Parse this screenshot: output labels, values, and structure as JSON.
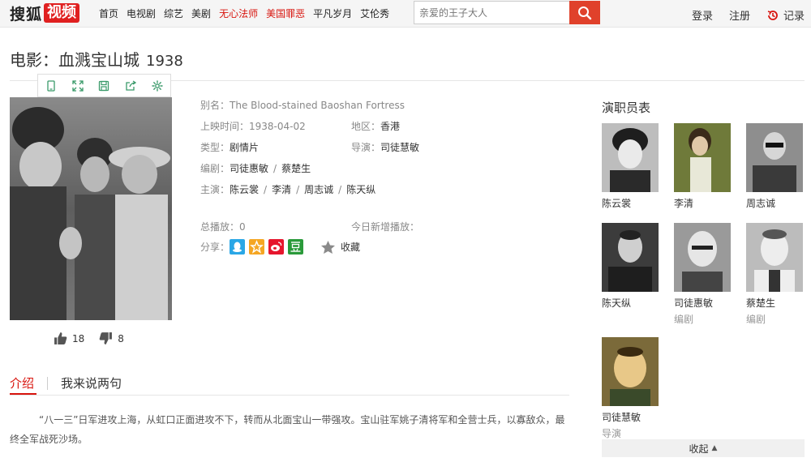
{
  "header": {
    "logo_text": "搜狐",
    "logo_badge": "视频",
    "nav": [
      {
        "label": "首页",
        "highlight": false
      },
      {
        "label": "电视剧",
        "highlight": false
      },
      {
        "label": "综艺",
        "highlight": false
      },
      {
        "label": "美剧",
        "highlight": false
      },
      {
        "label": "无心法师",
        "highlight": true
      },
      {
        "label": "美国罪恶",
        "highlight": true
      },
      {
        "label": "平凡岁月",
        "highlight": false
      },
      {
        "label": "艾伦秀",
        "highlight": false
      }
    ],
    "search_placeholder": "亲爱的王子大人",
    "login": "登录",
    "register": "注册",
    "history": "记录"
  },
  "title": {
    "main": "电影：血溅宝山城",
    "year": "1938"
  },
  "info": {
    "alias_label": "别名：",
    "alias": "The Blood-stained Baoshan Fortress",
    "release_label": "上映时间：",
    "release": "1938-04-02",
    "region_label": "地区：",
    "region": "香港",
    "genre_label": "类型：",
    "genre": "剧情片",
    "director_label": "导演：",
    "director": "司徒慧敏",
    "writer_label": "编剧：",
    "writers": [
      "司徒惠敏",
      "蔡楚生"
    ],
    "cast_label": "主演：",
    "cast": [
      "陈云裳",
      "李清",
      "周志诚",
      "陈天纵"
    ],
    "plays_label": "总播放：",
    "plays": "0",
    "today_label": "今日新增播放：",
    "today": "",
    "share_label": "分享：",
    "favorite": "收藏"
  },
  "votes": {
    "up": "18",
    "down": "8"
  },
  "tabs": {
    "intro": "介绍",
    "comment": "我来说两句"
  },
  "intro_text": "“八一三”日军进攻上海，从虹口正面进攻不下，转而从北面宝山一带强攻。宝山驻军姚子清将军和全营士兵，以寡敌众，最终全军战死沙场。",
  "cast_panel": {
    "title": "演职员表",
    "members": [
      {
        "name": "陈云裳",
        "role": ""
      },
      {
        "name": "李清",
        "role": ""
      },
      {
        "name": "周志诚",
        "role": ""
      },
      {
        "name": "陈天纵",
        "role": ""
      },
      {
        "name": "司徒惠敏",
        "role": "编剧"
      },
      {
        "name": "蔡楚生",
        "role": "编剧"
      },
      {
        "name": "司徒慧敏",
        "role": "导演"
      }
    ],
    "collapse": "收起"
  },
  "colors": {
    "brand_red": "#e02020",
    "nav_highlight": "#d8140d",
    "search_button": "#e0412b"
  }
}
